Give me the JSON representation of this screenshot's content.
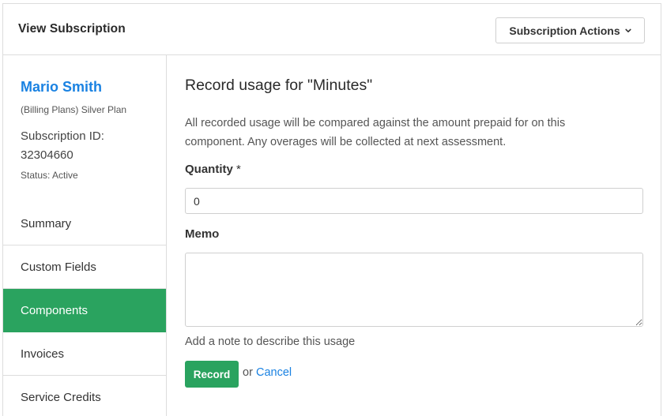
{
  "header": {
    "title": "View Subscription",
    "actions_label": "Subscription Actions",
    "actions_icon": "chevron-down-icon"
  },
  "sidebar": {
    "customer_name": "Mario Smith",
    "plan": "(Billing Plans) Silver Plan",
    "subscription_id_label": "Subscription ID:",
    "subscription_id": "32304660",
    "status": "Status: Active",
    "nav": [
      {
        "label": "Summary",
        "active": false
      },
      {
        "label": "Custom Fields",
        "active": false
      },
      {
        "label": "Components",
        "active": true
      },
      {
        "label": "Invoices",
        "active": false
      },
      {
        "label": "Service Credits",
        "active": false
      }
    ]
  },
  "main": {
    "title": "Record usage for \"Minutes\"",
    "description": "All recorded usage will be compared against the amount prepaid for on this component. Any overages will be collected at next assessment.",
    "quantity_label": "Quantity",
    "quantity_required_marker": "*",
    "quantity_value": "0",
    "memo_label": "Memo",
    "memo_value": "",
    "memo_hint": "Add a note to describe this usage",
    "record_label": "Record",
    "or_text": "or",
    "cancel_label": "Cancel"
  },
  "colors": {
    "accent_green": "#2aa35f",
    "link_blue": "#1a82e2",
    "border": "#dddddd"
  }
}
